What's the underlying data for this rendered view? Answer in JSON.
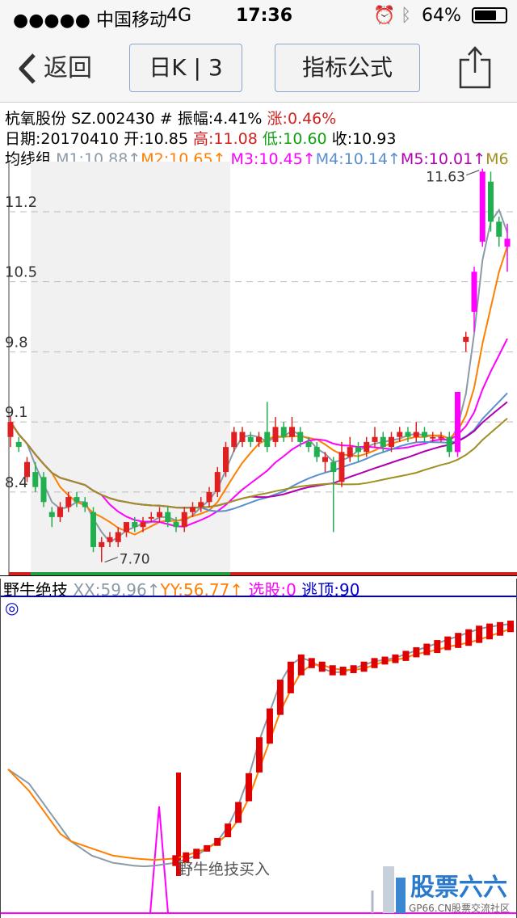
{
  "status": {
    "carrier": "●●●●● 中国移动",
    "network": "4G",
    "time": "17:36",
    "battery": "64%"
  },
  "nav": {
    "back_label": "返回",
    "period_label": "日K | 3",
    "formula_label": "指标公式"
  },
  "stock": {
    "name": "杭氧股份",
    "code": "SZ.002430",
    "amplitude": "# 振幅:4.41%",
    "change": "涨:0.46%",
    "date": "日期:20170410",
    "open": "开:10.85",
    "high": "高:11.08",
    "low": "低:10.60",
    "close": "收:10.93"
  },
  "ma_legend": {
    "group": "均线组",
    "items": [
      {
        "text": "M1:10.88↑",
        "color": "#8a9aa8"
      },
      {
        "text": "M2:10.65↑",
        "color": "#ff7f00"
      },
      {
        "text": "M3:10.45↑",
        "color": "#ff00ff"
      },
      {
        "text": "M4:10.14↑",
        "color": "#5a8fd0"
      },
      {
        "text": "M5:10.01↑",
        "color": "#b000b0"
      },
      {
        "text": "M6",
        "color": "#a09020"
      }
    ]
  },
  "indicator_legend": {
    "name": "野牛绝技",
    "items": [
      {
        "text": "XX:59.96↑",
        "color": "#8a9aa8"
      },
      {
        "text": "YY:56.77↑",
        "color": "#ff7f00"
      },
      {
        "text": "选股:0",
        "color": "#ff00ff"
      },
      {
        "text": "逃顶:90",
        "color": "#0000cc"
      }
    ],
    "mark": "◎",
    "annotation": "野牛绝技买入"
  },
  "watermark": {
    "brand": "股票六六",
    "sub": "GP66.CN股票交流社区"
  },
  "chart_data": [
    {
      "type": "candlestick",
      "y_ticks": [
        11.2,
        10.5,
        9.8,
        9.1,
        8.4
      ],
      "ylim": [
        7.6,
        11.7
      ],
      "annotations": [
        {
          "text": "11.63",
          "value": 11.63
        },
        {
          "text": "7.70",
          "value": 7.7
        }
      ],
      "candles": [
        {
          "o": 8.95,
          "c": 9.1,
          "h": 9.15,
          "l": 8.85
        },
        {
          "o": 8.9,
          "c": 8.85,
          "h": 8.95,
          "l": 8.8
        },
        {
          "o": 8.55,
          "c": 8.7,
          "h": 8.75,
          "l": 8.5
        },
        {
          "o": 8.6,
          "c": 8.45,
          "h": 8.7,
          "l": 8.4
        },
        {
          "o": 8.55,
          "c": 8.3,
          "h": 8.6,
          "l": 8.25
        },
        {
          "o": 8.2,
          "c": 8.15,
          "h": 8.25,
          "l": 8.05
        },
        {
          "o": 8.15,
          "c": 8.25,
          "h": 8.3,
          "l": 8.1
        },
        {
          "o": 8.25,
          "c": 8.35,
          "h": 8.4,
          "l": 8.2
        },
        {
          "o": 8.35,
          "c": 8.3,
          "h": 8.4,
          "l": 8.25
        },
        {
          "o": 8.3,
          "c": 8.25,
          "h": 8.35,
          "l": 8.2
        },
        {
          "o": 8.2,
          "c": 7.85,
          "h": 8.25,
          "l": 7.8
        },
        {
          "o": 7.85,
          "c": 7.9,
          "h": 7.95,
          "l": 7.7
        },
        {
          "o": 7.9,
          "c": 7.95,
          "h": 8.0,
          "l": 7.85
        },
        {
          "o": 7.9,
          "c": 8.0,
          "h": 8.05,
          "l": 7.85
        },
        {
          "o": 8.0,
          "c": 8.1,
          "h": 8.1,
          "l": 7.95
        },
        {
          "o": 8.1,
          "c": 8.05,
          "h": 8.15,
          "l": 8.0
        },
        {
          "o": 8.05,
          "c": 8.1,
          "h": 8.15,
          "l": 8.0
        },
        {
          "o": 8.15,
          "c": 8.15,
          "h": 8.2,
          "l": 8.1
        },
        {
          "o": 8.15,
          "c": 8.2,
          "h": 8.25,
          "l": 8.1
        },
        {
          "o": 8.2,
          "c": 8.1,
          "h": 8.25,
          "l": 8.05
        },
        {
          "o": 8.1,
          "c": 8.05,
          "h": 8.15,
          "l": 8.0
        },
        {
          "o": 8.05,
          "c": 8.2,
          "h": 8.25,
          "l": 8.0
        },
        {
          "o": 8.2,
          "c": 8.25,
          "h": 8.3,
          "l": 8.15
        },
        {
          "o": 8.25,
          "c": 8.3,
          "h": 8.35,
          "l": 8.2
        },
        {
          "o": 8.3,
          "c": 8.4,
          "h": 8.45,
          "l": 8.25
        },
        {
          "o": 8.4,
          "c": 8.6,
          "h": 8.65,
          "l": 8.35
        },
        {
          "o": 8.6,
          "c": 8.85,
          "h": 8.9,
          "l": 8.55
        },
        {
          "o": 8.85,
          "c": 9.0,
          "h": 9.05,
          "l": 8.8
        },
        {
          "o": 8.9,
          "c": 9.0,
          "h": 9.05,
          "l": 8.85
        },
        {
          "o": 8.95,
          "c": 8.9,
          "h": 9.0,
          "l": 8.85
        },
        {
          "o": 8.9,
          "c": 8.95,
          "h": 9.0,
          "l": 8.85
        },
        {
          "o": 9.0,
          "c": 8.85,
          "h": 9.3,
          "l": 8.8
        },
        {
          "o": 8.9,
          "c": 9.05,
          "h": 9.15,
          "l": 8.85
        },
        {
          "o": 9.05,
          "c": 8.95,
          "h": 9.1,
          "l": 8.9
        },
        {
          "o": 8.95,
          "c": 9.05,
          "h": 9.15,
          "l": 8.9
        },
        {
          "o": 9.0,
          "c": 8.9,
          "h": 9.05,
          "l": 8.85
        },
        {
          "o": 8.9,
          "c": 8.85,
          "h": 8.95,
          "l": 8.8
        },
        {
          "o": 8.85,
          "c": 8.75,
          "h": 8.9,
          "l": 8.7
        },
        {
          "o": 8.7,
          "c": 8.75,
          "h": 8.8,
          "l": 8.6
        },
        {
          "o": 8.7,
          "c": 8.6,
          "h": 8.75,
          "l": 8.0
        },
        {
          "o": 8.5,
          "c": 8.8,
          "h": 8.9,
          "l": 8.45
        },
        {
          "o": 8.75,
          "c": 8.85,
          "h": 8.95,
          "l": 8.7
        },
        {
          "o": 8.85,
          "c": 8.8,
          "h": 8.9,
          "l": 8.7
        },
        {
          "o": 8.8,
          "c": 8.9,
          "h": 8.95,
          "l": 8.75
        },
        {
          "o": 8.9,
          "c": 8.95,
          "h": 9.05,
          "l": 8.85
        },
        {
          "o": 8.95,
          "c": 8.85,
          "h": 9.0,
          "l": 8.8
        },
        {
          "o": 8.85,
          "c": 8.95,
          "h": 9.0,
          "l": 8.8
        },
        {
          "o": 8.95,
          "c": 9.0,
          "h": 9.05,
          "l": 8.9
        },
        {
          "o": 9.0,
          "c": 8.95,
          "h": 9.05,
          "l": 8.9
        },
        {
          "o": 8.95,
          "c": 9.0,
          "h": 9.1,
          "l": 8.9
        },
        {
          "o": 9.0,
          "c": 8.95,
          "h": 9.05,
          "l": 8.9
        },
        {
          "o": 8.95,
          "c": 8.95,
          "h": 9.0,
          "l": 8.9
        },
        {
          "o": 8.95,
          "c": 8.95,
          "h": 9.0,
          "l": 8.9
        },
        {
          "o": 8.95,
          "c": 8.8,
          "h": 9.0,
          "l": 8.75
        },
        {
          "o": 8.8,
          "c": 9.4,
          "h": 9.4,
          "l": 8.75
        },
        {
          "o": 9.9,
          "c": 9.95,
          "h": 10.0,
          "l": 9.8
        },
        {
          "o": 10.2,
          "c": 10.6,
          "h": 10.65,
          "l": 10.0
        },
        {
          "o": 10.9,
          "c": 11.6,
          "h": 11.63,
          "l": 10.85
        },
        {
          "o": 11.5,
          "c": 11.1,
          "h": 11.6,
          "l": 11.0
        },
        {
          "o": 11.1,
          "c": 10.95,
          "h": 11.15,
          "l": 10.85
        },
        {
          "o": 10.85,
          "c": 10.93,
          "h": 11.08,
          "l": 10.6
        }
      ]
    },
    {
      "type": "line",
      "series": [
        {
          "name": "XX",
          "values": [
            40,
            39,
            38,
            36,
            34,
            32,
            30,
            29,
            28,
            27.5,
            27,
            26.8,
            26.6,
            26.5,
            26.6,
            26.8,
            27,
            27.5,
            28,
            29,
            30,
            32,
            35,
            39,
            44,
            48,
            52,
            54.5,
            55.5,
            55,
            54,
            53.5,
            53.5,
            54,
            54.5,
            55,
            55.2,
            55.5,
            56,
            56.5,
            57,
            57.5,
            58,
            58.5,
            59,
            59.5,
            59.8,
            60,
            60.2
          ]
        },
        {
          "name": "YY",
          "values": [
            40,
            38.5,
            37,
            35,
            33,
            31,
            30,
            29.5,
            29,
            28.5,
            28,
            27.8,
            27.6,
            27.5,
            27.4,
            27.5,
            27.6,
            28,
            28.5,
            29,
            29.8,
            31,
            33,
            36,
            40,
            44,
            48,
            51,
            53.5,
            54.5,
            54.5,
            54,
            53.8,
            53.8,
            54,
            54.5,
            55,
            55.2,
            55.5,
            56,
            56.3,
            56.6,
            57,
            57.3,
            57.6,
            58,
            58.5,
            59,
            59.5
          ]
        }
      ]
    }
  ]
}
